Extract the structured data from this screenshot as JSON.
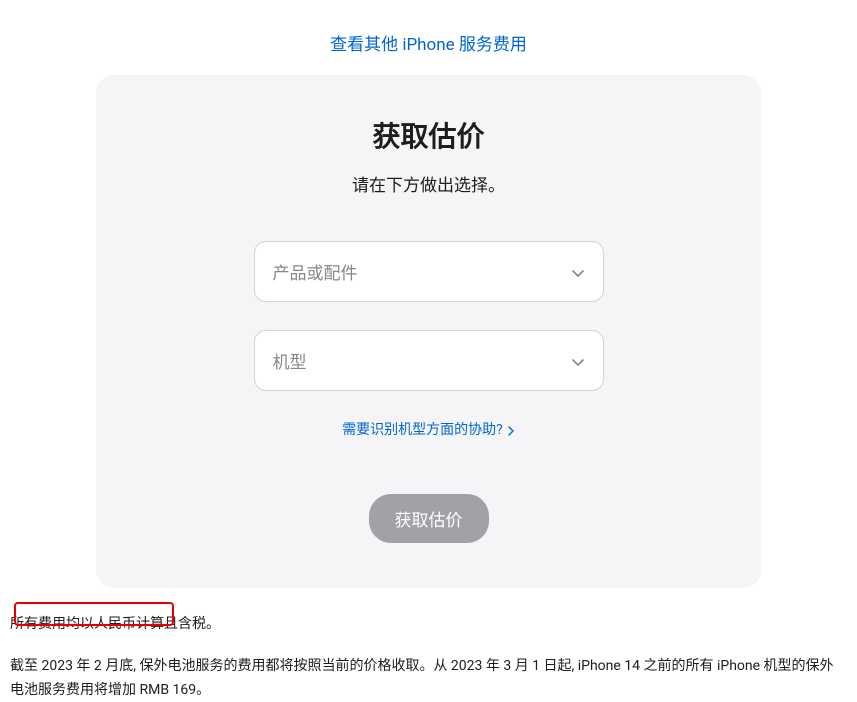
{
  "topLink": {
    "label": "查看其他 iPhone 服务费用"
  },
  "card": {
    "title": "获取估价",
    "subtitle": "请在下方做出选择。",
    "select1": {
      "placeholder": "产品或配件"
    },
    "select2": {
      "placeholder": "机型"
    },
    "helpLink": {
      "label": "需要识别机型方面的协助?"
    },
    "submitButton": {
      "label": "获取估价"
    }
  },
  "footnotes": {
    "line1": "所有费用均以人民币计算且含税。",
    "line2_part1": "截至 2023 年 2 月底, 保外电池服务的费用都将按照当前的价格收取。从 2023 年 3 月 1 日起, iPhone 14 之前的所有 iPhone 机型的保外电池服务",
    "line2_part2": "费用将增加 RMB 169。"
  }
}
